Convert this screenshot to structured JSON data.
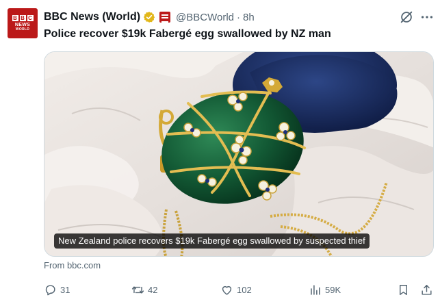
{
  "post": {
    "avatar": {
      "blocks": [
        "B",
        "B",
        "C"
      ],
      "line1": "NEWS",
      "line2": "WORLD"
    },
    "display_name": "BBC News (World)",
    "handle": "@BBCWorld",
    "separator": "·",
    "time": "8h",
    "text": "Police recover $19k Fabergé egg swallowed by NZ man",
    "media_caption": "New Zealand police recovers $19k Fabergé egg swallowed by suspected thief",
    "source": "From bbc.com",
    "metrics": {
      "replies": "31",
      "reposts": "42",
      "likes": "102",
      "views": "59K"
    }
  },
  "colors": {
    "brand": "#bb1919",
    "verified_badge": "#e2b719",
    "secondary_text": "#536471",
    "primary_text": "#0f1419"
  },
  "icons": [
    "grok-icon",
    "more-icon",
    "verified-badge-icon",
    "affiliate-badge-icon",
    "reply-icon",
    "repost-icon",
    "like-icon",
    "views-icon",
    "bookmark-icon",
    "share-icon"
  ]
}
